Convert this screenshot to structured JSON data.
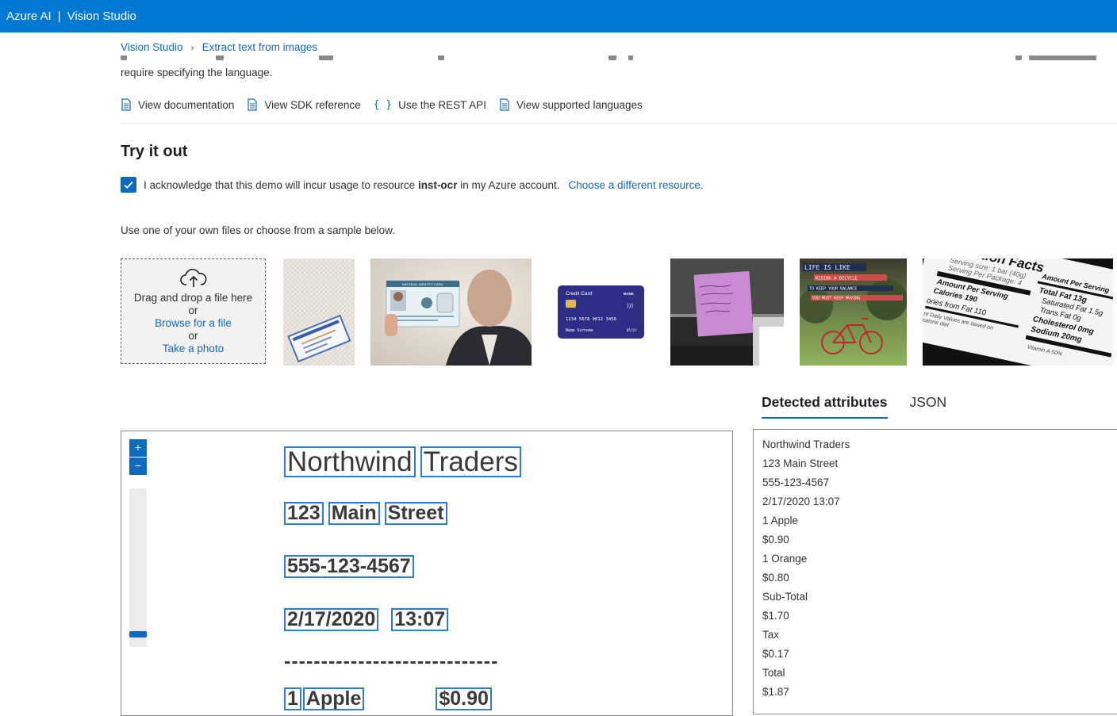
{
  "topbar": {
    "brand": "Azure AI",
    "separator": "|",
    "product": "Vision Studio"
  },
  "breadcrumb": {
    "home": "Vision Studio",
    "current": "Extract text from images"
  },
  "description_tail": "require specifying the language.",
  "quick_links": [
    {
      "label": "View documentation",
      "icon": "document-icon"
    },
    {
      "label": "View SDK reference",
      "icon": "document-icon"
    },
    {
      "label": "Use the REST API",
      "icon": "braces-icon"
    },
    {
      "label": "View supported languages",
      "icon": "document-icon"
    }
  ],
  "try_it": {
    "title": "Try it out",
    "ack_prefix": "I acknowledge that this demo will incur usage to resource ",
    "resource_name": "inst-ocr",
    "ack_suffix": " in my Azure account.",
    "change_link": "Choose a different resource.",
    "use_text": "Use one of your own files or choose from a sample below."
  },
  "dropzone": {
    "line1": "Drag and drop a file here",
    "or1": "or",
    "browse": "Browse for a file",
    "or2": "or",
    "photo": "Take a photo"
  },
  "samples": {
    "id_card_title": "NATIONAL IDENTITY CARD",
    "credit_card_title": "Credit Card",
    "credit_card_bank": "BANK",
    "credit_card_number": "1234 5678 9012 3456",
    "credit_card_name": "Name Surname",
    "credit_card_exp": "05/23",
    "poster_lines": [
      "LIFE IS LIKE",
      "RIDING A BICYCLE",
      "TO KEEP YOUR BALANCE",
      "YOU MUST KEEP MOVING"
    ],
    "nutrition": {
      "title": "Nutrition Facts",
      "serving_size": "Serving size: 1 bar (40g)",
      "servings": "Serving Per Package: 4",
      "amount_per_serving": "Amount Per Serving",
      "calories": "Calories 190",
      "calories_fat": "ories from Fat 110",
      "daily": "nt Daily Values are based on",
      "diet": "calorie diet",
      "total_fat": "Total Fat 13g",
      "sat_fat": "Saturated Fat 1.5g",
      "trans_fat": "Trans Fat 0g",
      "cholesterol": "Cholesterol 0mg",
      "sodium": "Sodium 20mg",
      "vitamin": "Vitamin A 50%"
    }
  },
  "result_tabs": {
    "detected": "Detected attributes",
    "json": "JSON"
  },
  "viewer": {
    "zoom_in": "+",
    "zoom_out": "−",
    "receipt": {
      "line1": [
        "Northwind",
        "Traders"
      ],
      "line2": [
        "123",
        "Main",
        "Street"
      ],
      "line3": [
        "555-123-4567"
      ],
      "line4": [
        "2/17/2020",
        "13:07"
      ],
      "divider": "-----------------------------",
      "line6": [
        "1",
        "Apple",
        "$0.90"
      ]
    }
  },
  "detected_lines": [
    "Northwind Traders",
    "123 Main Street",
    "555-123-4567",
    "2/17/2020 13:07",
    "1 Apple",
    "$0.90",
    "1 Orange",
    "$0.80",
    "Sub-Total",
    "$1.70",
    "Tax",
    "$0.17",
    "Total",
    "$1.87"
  ],
  "colors": {
    "accent": "#0078d4",
    "link": "#0f6cbd",
    "bbox": "#2b7cd3"
  }
}
